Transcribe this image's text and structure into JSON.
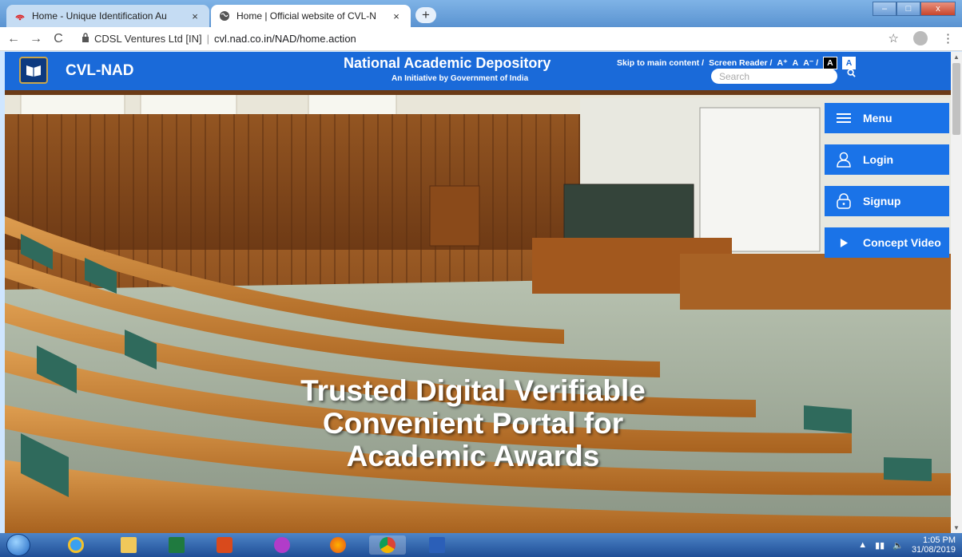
{
  "browser": {
    "tabs": [
      {
        "title": "Home - Unique Identification Au",
        "close": "×",
        "active": false
      },
      {
        "title": "Home | Official website of CVL-N",
        "close": "×",
        "active": true
      }
    ],
    "new_tab": "+",
    "window_controls": {
      "minimize": "–",
      "maximize": "□",
      "close": "x"
    },
    "nav": {
      "back": "←",
      "forward": "→",
      "reload": "C"
    },
    "site_identity": "CDSL Ventures Ltd [IN]",
    "separator": "|",
    "url": "cvl.nad.co.in/NAD/home.action",
    "star": "☆",
    "menu": "⋮"
  },
  "site": {
    "brand": "CVL-NAD",
    "title": "National Academic Depository",
    "subtitle": "An Initiative by Government of India",
    "accessibility": {
      "skip": "Skip to main content /",
      "reader": "Screen Reader /",
      "font_plus": "A⁺",
      "font_normal": "A",
      "font_minus": "A⁻ /",
      "contrast_dark": "A",
      "contrast_light": "A"
    },
    "search_placeholder": "Search",
    "search_icon": "🔍"
  },
  "hero": {
    "line1": "Trusted Digital Verifiable",
    "line2": "Convenient Portal for",
    "line3": "Academic Awards"
  },
  "side_menu": [
    {
      "label": "Menu",
      "icon": "hamburger-icon"
    },
    {
      "label": "Login",
      "icon": "user-icon"
    },
    {
      "label": "Signup",
      "icon": "lock-icon"
    },
    {
      "label": "Concept Video",
      "icon": "play-icon"
    }
  ],
  "taskbar": {
    "time": "1:05 PM",
    "date": "31/08/2019"
  },
  "colors": {
    "header_blue": "#1a6ad9",
    "button_blue": "#1a73e8",
    "taskbar": "#2a5fa8"
  }
}
